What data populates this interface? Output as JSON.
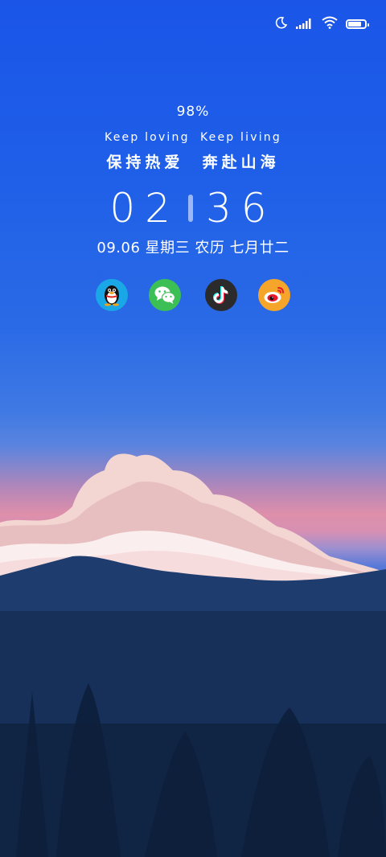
{
  "status_bar": {
    "icons": [
      "moon-icon",
      "signal-icon",
      "wifi-icon",
      "battery-icon"
    ],
    "battery_level": 0.9
  },
  "lock_screen": {
    "battery_percent": "98%",
    "slogan_en": "Keep loving  Keep living",
    "slogan_cn": "保持热爱  奔赴山海",
    "time": {
      "hour": "02",
      "minute": "36"
    },
    "date": "09.06 星期三 农历 七月廿二"
  },
  "shortcuts": [
    {
      "name": "qq",
      "icon": "qq-penguin-icon",
      "color": "#1aa7e6"
    },
    {
      "name": "wechat",
      "icon": "wechat-icon",
      "color": "#3cbf55"
    },
    {
      "name": "tiktok",
      "icon": "tiktok-icon",
      "color": "#2b2b2b"
    },
    {
      "name": "weibo",
      "icon": "weibo-icon",
      "color": "#f4a52a"
    }
  ]
}
